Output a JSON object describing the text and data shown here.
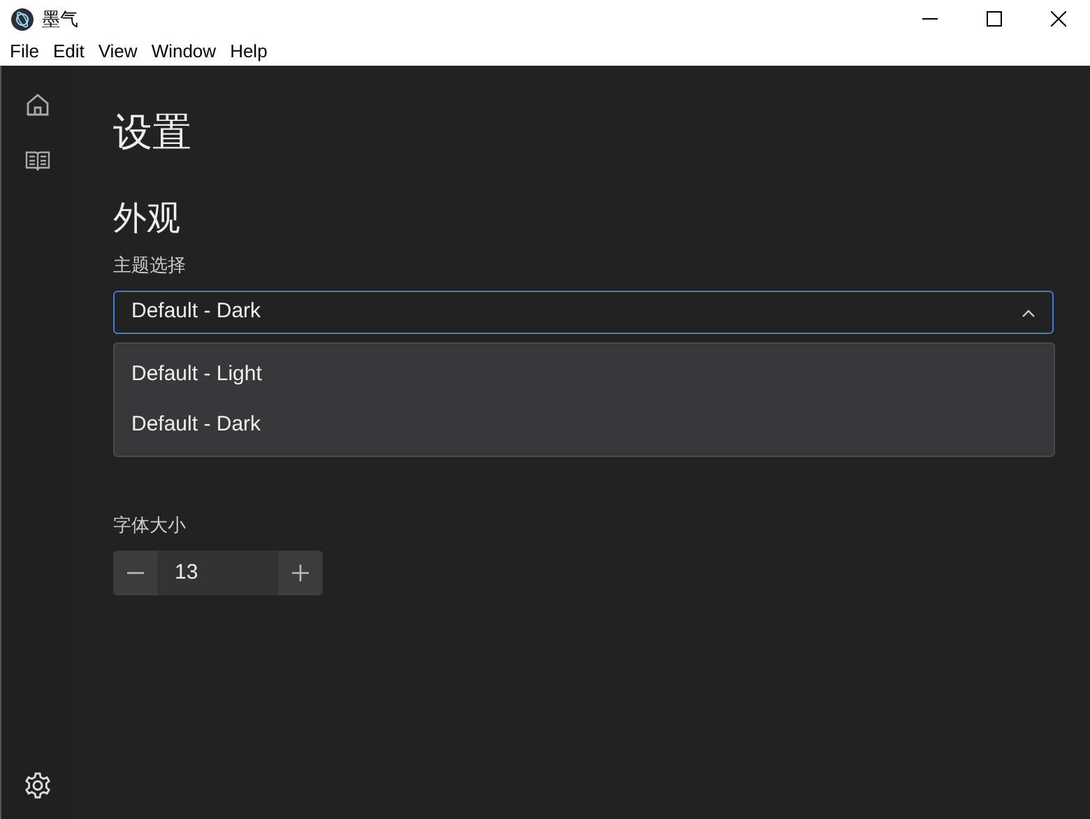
{
  "window": {
    "title": "墨气"
  },
  "menu_bar": [
    "File",
    "Edit",
    "View",
    "Window",
    "Help"
  ],
  "sidebar": {
    "items": [
      {
        "kind": "home"
      },
      {
        "kind": "book"
      }
    ],
    "footer": {
      "kind": "settings"
    }
  },
  "page_title": "设置",
  "sections": [
    {
      "heading": "外观",
      "label": "主题选择",
      "kind": "select",
      "value": "Default - Dark",
      "expanded": true,
      "options": [
        "Default - Light",
        "Default - Dark"
      ]
    },
    {
      "label": "字体大小",
      "kind": "stepper",
      "value": "13"
    }
  ]
}
